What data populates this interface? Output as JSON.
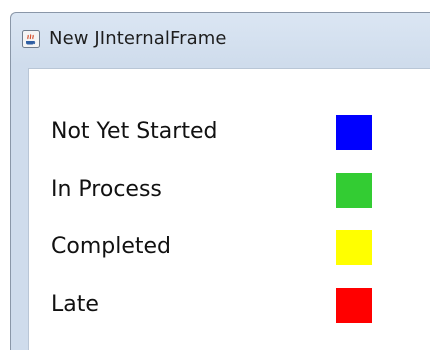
{
  "window": {
    "title": "New JInternalFrame",
    "icon": "java-coffee-cup-icon"
  },
  "legend": {
    "items": [
      {
        "label": "Not Yet Started",
        "color": "#0000ff"
      },
      {
        "label": "In Process",
        "color": "#33cc33"
      },
      {
        "label": "Completed",
        "color": "#ffff00"
      },
      {
        "label": "Late",
        "color": "#ff0000"
      }
    ]
  }
}
